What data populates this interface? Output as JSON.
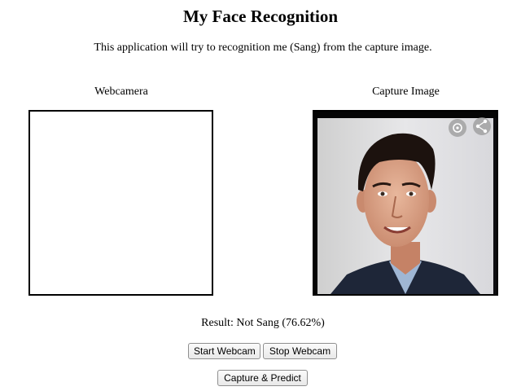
{
  "page": {
    "title": "My Face Recognition",
    "subtitle": "This application will try to recognition me (Sang) from the capture image."
  },
  "webcam": {
    "label": "Webcamera"
  },
  "capture": {
    "label": "Capture Image"
  },
  "result": {
    "text": "Result: Not Sang (76.62%)"
  },
  "buttons": {
    "start_webcam": "Start Webcam",
    "stop_webcam": "Stop Webcam",
    "capture_predict": "Capture & Predict"
  },
  "icons": {
    "capture_overlay": [
      "focus-icon",
      "share-icon"
    ]
  },
  "colors": {
    "frame_border": "#000000",
    "button_border": "#8f8f8f"
  }
}
